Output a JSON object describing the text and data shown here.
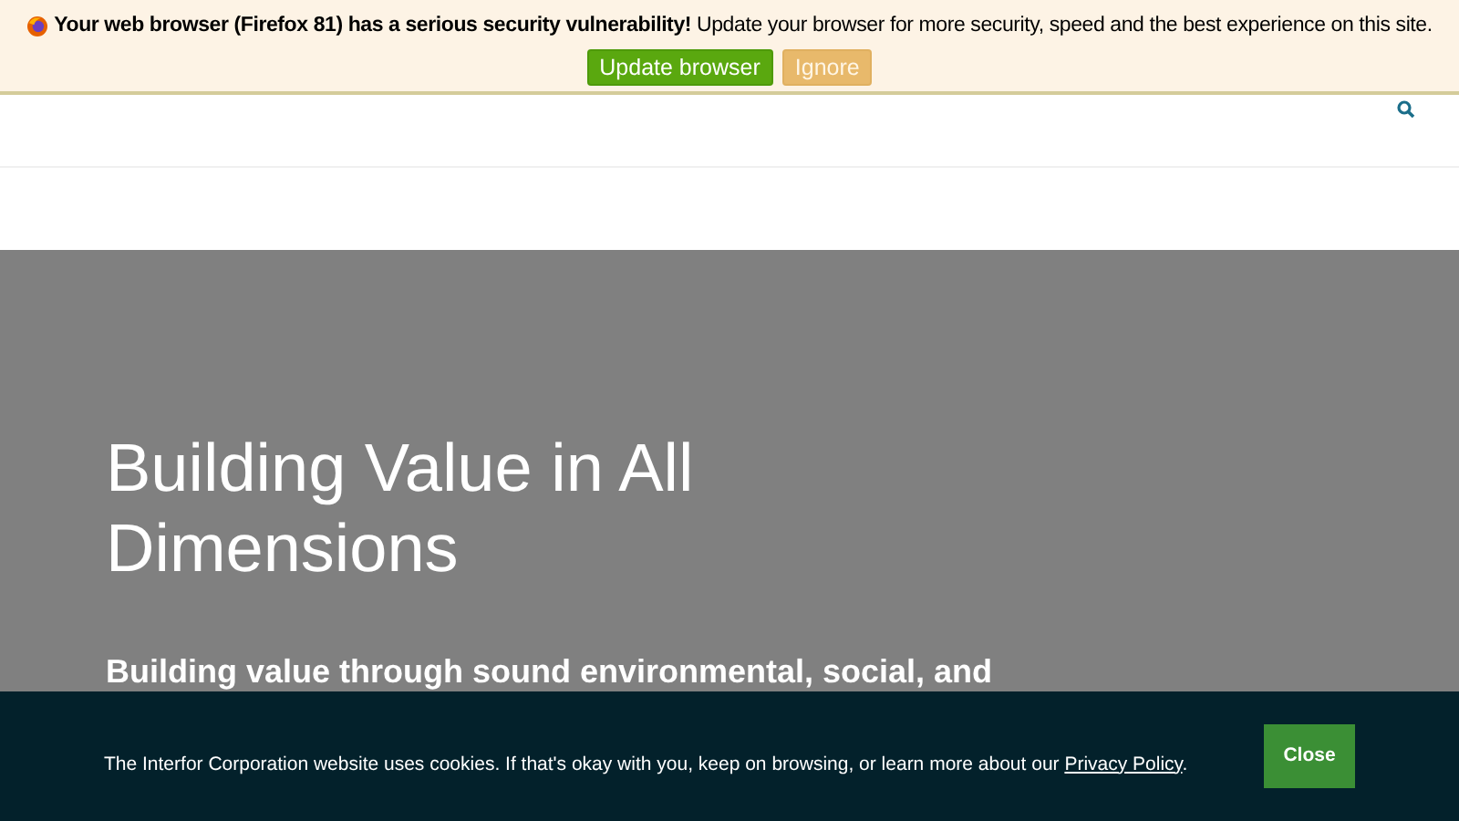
{
  "browser_notice": {
    "message": "**Your web browser (Firefox 81) has a serious security vulnerability!** Update your browser for more security, speed and the best experience on this site.",
    "buttons": [
      {
        "label": "Update browser",
        "kind": "primary"
      },
      {
        "label": "Ignore",
        "kind": "secondary"
      }
    ]
  },
  "hero": {
    "title": "Building Value in All Dimensions",
    "subtitle": "Building value through sound environmental, social, and"
  },
  "cookie_notice": {
    "text": "The Interfor Corporation website uses cookies. If that's okay with you, keep on browsing, or learn more about our ",
    "link": "Privacy Policy",
    "text_end": ".",
    "button": "Close"
  }
}
